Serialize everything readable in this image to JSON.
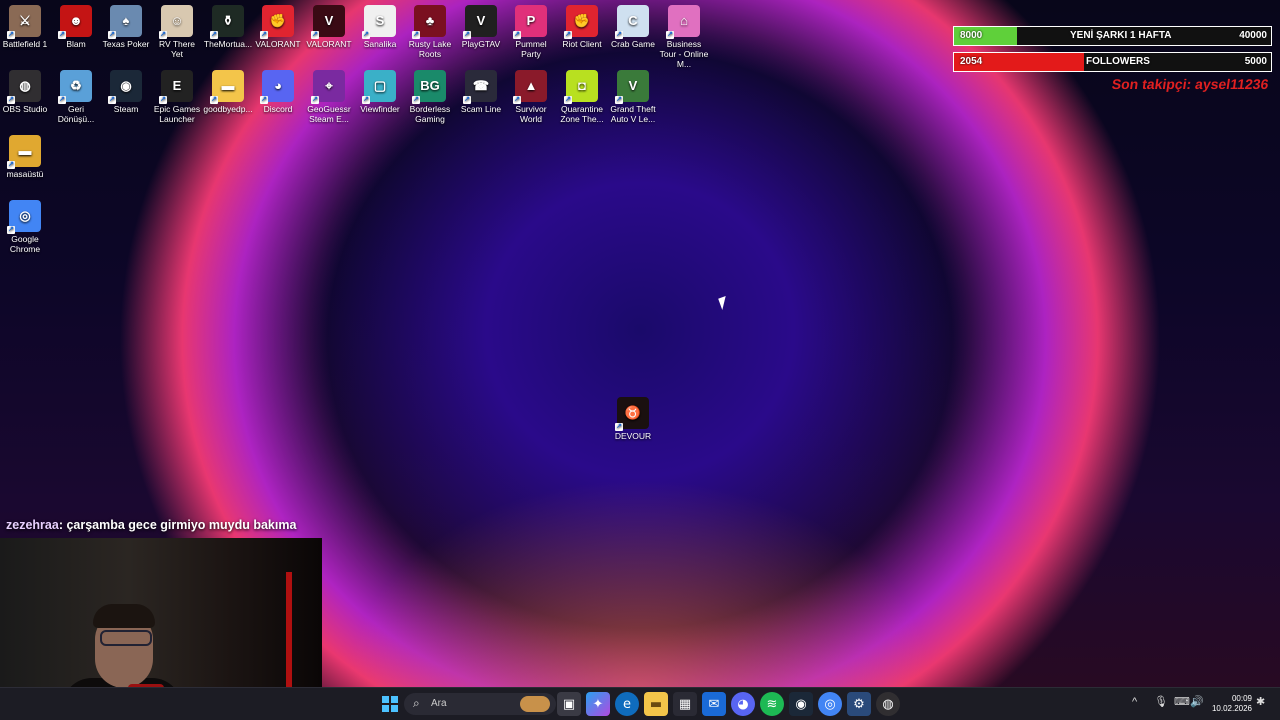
{
  "desktop_icons": [
    {
      "label": "Battlefield 1",
      "icon": "battlefield-icon",
      "color": "#8a6a55"
    },
    {
      "label": "Blam",
      "icon": "blam-icon",
      "color": "#c41414"
    },
    {
      "label": "Texas Poker",
      "icon": "poker-icon",
      "color": "#6a8ab0"
    },
    {
      "label": "RV There Yet",
      "icon": "rv-icon",
      "color": "#d8c8b0"
    },
    {
      "label": "TheMortua...",
      "icon": "mortuary-icon",
      "color": "#1e2a24"
    },
    {
      "label": "VALORANT",
      "icon": "riot-icon",
      "color": "#e02430"
    },
    {
      "label": "VALORANT",
      "icon": "valorant-icon",
      "color": "#3a0a14"
    },
    {
      "label": "Sanalika",
      "icon": "sanalika-icon",
      "color": "#f0f0f0"
    },
    {
      "label": "Rusty Lake Roots",
      "icon": "rusty-lake-icon",
      "color": "#7a1020"
    },
    {
      "label": "PlayGTAV",
      "icon": "gtav-icon",
      "color": "#202020"
    },
    {
      "label": "Pummel Party",
      "icon": "pummel-party-icon",
      "color": "#e0307a"
    },
    {
      "label": "Riot Client",
      "icon": "riot-client-icon",
      "color": "#e02430"
    },
    {
      "label": "Crab Game",
      "icon": "crab-game-icon",
      "color": "#cfe0f0"
    },
    {
      "label": "Business Tour - Online M...",
      "icon": "business-tour-icon",
      "color": "#e070c0"
    },
    {
      "label": "OBS Studio",
      "icon": "obs-icon",
      "color": "#302e31"
    },
    {
      "label": "Geri Dönüşü...",
      "icon": "recycle-bin-icon",
      "color": "#5aa0d8"
    },
    {
      "label": "Steam",
      "icon": "steam-icon",
      "color": "#1b2838"
    },
    {
      "label": "Epic Games Launcher",
      "icon": "epic-games-icon",
      "color": "#222222"
    },
    {
      "label": "goodbyedp...",
      "icon": "folder-icon",
      "color": "#f3c54a"
    },
    {
      "label": "Discord",
      "icon": "discord-icon",
      "color": "#5865f2"
    },
    {
      "label": "GeoGuessr Steam E...",
      "icon": "geoguessr-icon",
      "color": "#7a2aa0"
    },
    {
      "label": "Viewfinder",
      "icon": "viewfinder-icon",
      "color": "#3ab0c8"
    },
    {
      "label": "Borderless Gaming",
      "icon": "borderless-gaming-icon",
      "color": "#1a8a6a"
    },
    {
      "label": "Scam Line",
      "icon": "scam-line-icon",
      "color": "#2a2a3a"
    },
    {
      "label": "Survivor World",
      "icon": "survivor-world-icon",
      "color": "#8a1a2a"
    },
    {
      "label": "Quarantine Zone The...",
      "icon": "quarantine-zone-icon",
      "color": "#b8e020"
    },
    {
      "label": "Grand Theft Auto V Le...",
      "icon": "gta-v-icon",
      "color": "#3a7a3a"
    },
    {
      "label": "masaüstü",
      "icon": "folder-icon",
      "color": "#e0a830"
    },
    {
      "label": "Google Chrome",
      "icon": "chrome-icon",
      "color": "#4285f4"
    },
    {
      "label": "DEVOUR",
      "icon": "devour-icon",
      "color": "#1a1010"
    }
  ],
  "overlay": {
    "goal1": {
      "current": "8000",
      "label": "YENİ ŞARKI 1 HAFTA",
      "target": "40000",
      "color": "#5fd03a",
      "progress": 0.2
    },
    "goal2": {
      "current": "2054",
      "label": "FOLLOWERS",
      "target": "5000",
      "color": "#e31a1a",
      "progress": 0.41
    },
    "last_follower": "Son takipçi: aysel11236"
  },
  "chat": {
    "user": "zezehraa",
    "message": ": çarşamba gece girmiyo muydu bakıma"
  },
  "taskbar": {
    "search_placeholder": "Ara",
    "clock_time": "00:09",
    "clock_date": "10.02.2026"
  }
}
